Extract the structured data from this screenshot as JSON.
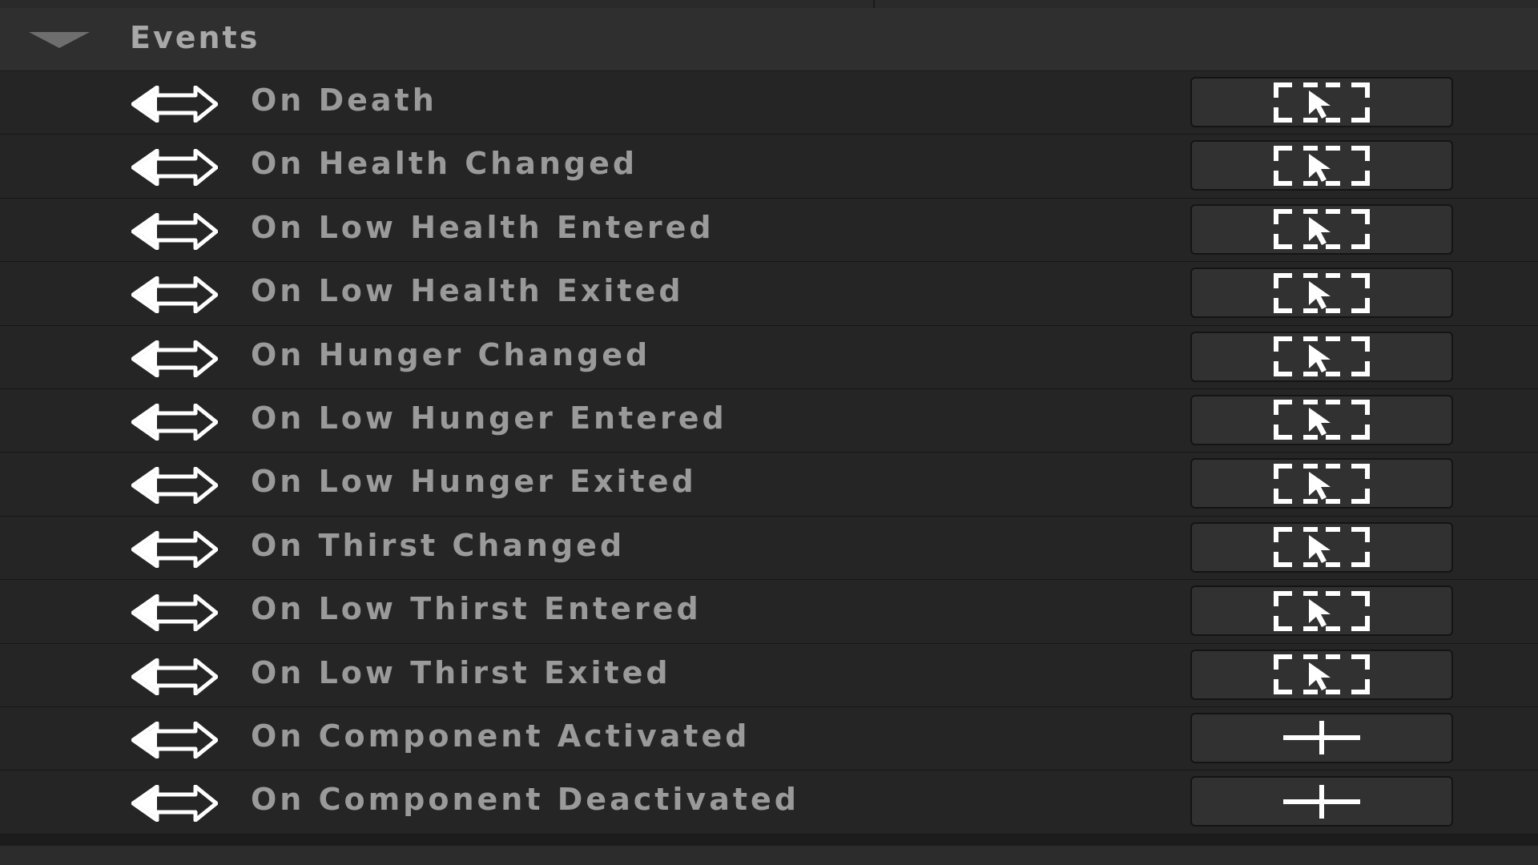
{
  "section": {
    "title": "Events",
    "collapse_icon": "triangle-down-icon",
    "expanded": true
  },
  "events": [
    {
      "label": "On Death",
      "action_icon": "select-cursor-icon"
    },
    {
      "label": "On Health Changed",
      "action_icon": "select-cursor-icon"
    },
    {
      "label": "On Low Health Entered",
      "action_icon": "select-cursor-icon"
    },
    {
      "label": "On Low Health Exited",
      "action_icon": "select-cursor-icon"
    },
    {
      "label": "On Hunger Changed",
      "action_icon": "select-cursor-icon"
    },
    {
      "label": "On Low Hunger Entered",
      "action_icon": "select-cursor-icon"
    },
    {
      "label": "On Low Hunger Exited",
      "action_icon": "select-cursor-icon"
    },
    {
      "label": "On Thirst Changed",
      "action_icon": "select-cursor-icon"
    },
    {
      "label": "On Low Thirst Entered",
      "action_icon": "select-cursor-icon"
    },
    {
      "label": "On Low Thirst Exited",
      "action_icon": "select-cursor-icon"
    },
    {
      "label": "On Component Activated",
      "action_icon": "plus-icon"
    },
    {
      "label": "On Component Deactivated",
      "action_icon": "plus-icon"
    }
  ],
  "row_icon": "event-diamond-arrow-icon",
  "colors": {
    "background": "#1c1c1c",
    "header": "#2f2f2f",
    "row": "#252525",
    "button": "#313131",
    "text": "#9a9a9a",
    "icon": "#ffffff"
  }
}
